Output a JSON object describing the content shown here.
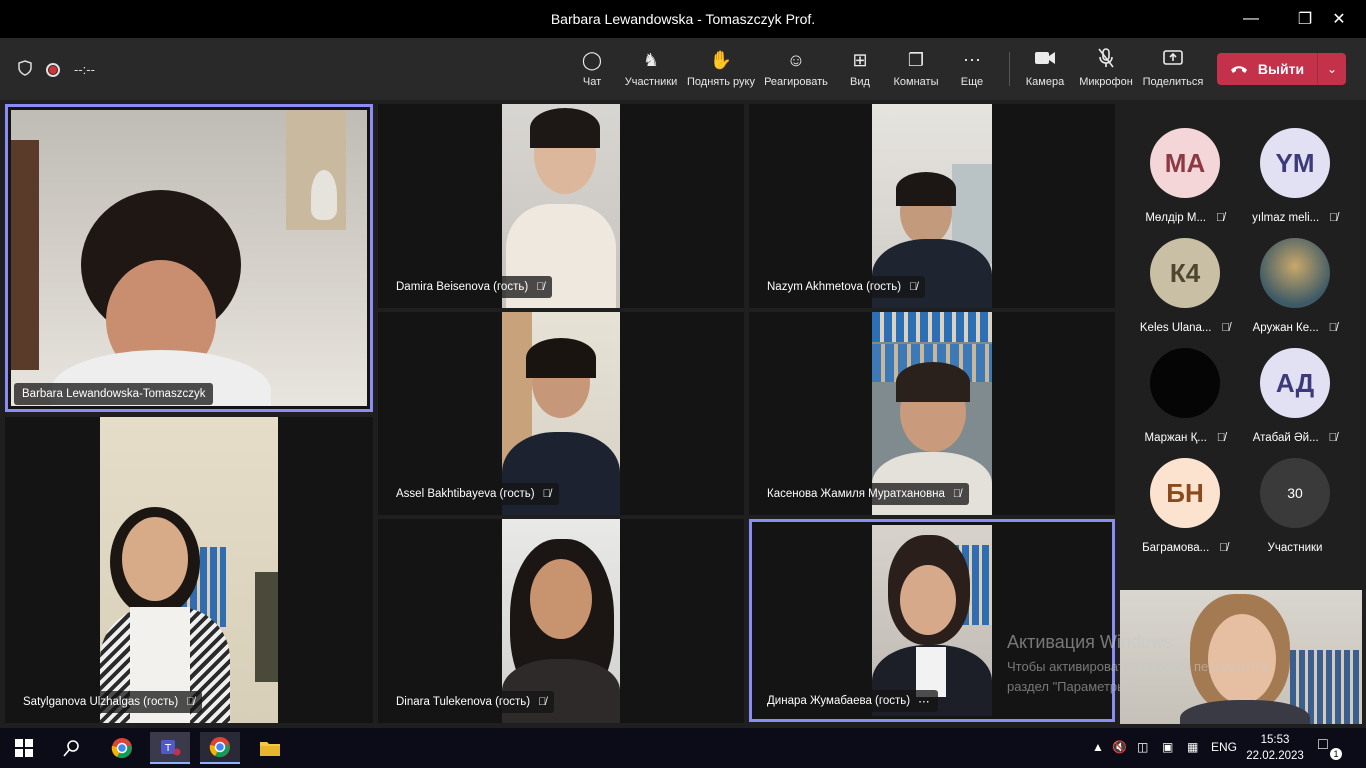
{
  "window": {
    "title": "Barbara Lewandowska - Tomaszczyk Prof."
  },
  "toolbar": {
    "timer": "--:--",
    "chat": "Чат",
    "participants": "Участники",
    "raise_hand": "Поднять руку",
    "react": "Реагировать",
    "view": "Вид",
    "rooms": "Комнаты",
    "more": "Еще",
    "camera": "Камера",
    "mic": "Микрофон",
    "share": "Поделиться",
    "leave": "Выйти"
  },
  "tiles": [
    {
      "name": "Barbara Lewandowska-Tomaszczyk"
    },
    {
      "name": "Damira Beisenova (гость)"
    },
    {
      "name": "Nazym Akhmetova (гость)"
    },
    {
      "name": "Assel Bakhtibayeva (гость)"
    },
    {
      "name": "Касенова Жамиля Муратхановна"
    },
    {
      "name": "Satylganova Ulzhalgas (гость)"
    },
    {
      "name": "Dinara Tulekenova (гость)"
    },
    {
      "name": "Динара Жумабаева (гость)"
    }
  ],
  "roster": [
    {
      "initials": "МА",
      "name": "Мөлдір М...",
      "bg": "#f4d5d8",
      "fg": "#8b3a44"
    },
    {
      "initials": "YM",
      "name": "yılmaz meli...",
      "bg": "#e2e0f3",
      "fg": "#3d3a7a"
    },
    {
      "initials": "К4",
      "name": "Keles Ulana...",
      "bg": "#c8bfa4",
      "fg": "#4f4630"
    },
    {
      "initials": "",
      "name": "Аружан Ке...",
      "bg": "#4a6a7a",
      "fg": "#fff"
    },
    {
      "initials": "",
      "name": "Маржан Қ...",
      "bg": "#050505",
      "fg": "#fff"
    },
    {
      "initials": "АД",
      "name": "Атабай Әй...",
      "bg": "#e2e0f3",
      "fg": "#3d3a7a"
    },
    {
      "initials": "БН",
      "name": "Баграмова...",
      "bg": "#fbe3cf",
      "fg": "#8a4a1c"
    },
    {
      "initials": "30",
      "name": "Участники",
      "bg": "#3a3a3a",
      "fg": "#fff"
    }
  ],
  "watermark": {
    "title": "Активация Windows",
    "line1": "Чтобы активировать Windows, перейдите в",
    "line2": "раздел \"Параметры\"."
  },
  "taskbar": {
    "lang": "ENG",
    "time": "15:53",
    "date": "22.02.2023",
    "notif": "1"
  }
}
